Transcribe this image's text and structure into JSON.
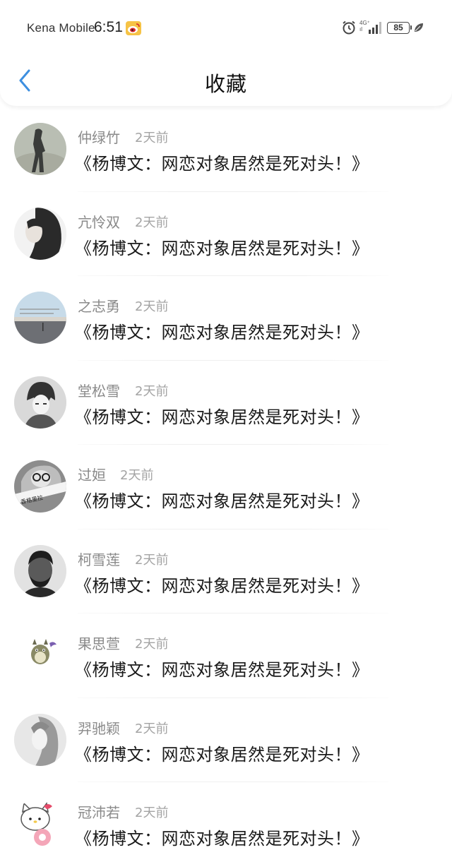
{
  "status_bar": {
    "carrier": "Kena Mobile",
    "time": "6:51",
    "network": "4G⁺",
    "network_sub": "ıl",
    "battery": "85"
  },
  "header": {
    "title": "收藏"
  },
  "items": [
    {
      "name": "仲绿竹",
      "time": "2天前",
      "title": "《杨博文：网恋对象居然是死对头！》"
    },
    {
      "name": "亢怜双",
      "time": "2天前",
      "title": "《杨博文：网恋对象居然是死对头！》"
    },
    {
      "name": "之志勇",
      "time": "2天前",
      "title": "《杨博文：网恋对象居然是死对头！》"
    },
    {
      "name": "堂松雪",
      "time": "2天前",
      "title": "《杨博文：网恋对象居然是死对头！》"
    },
    {
      "name": "过姮",
      "time": "2天前",
      "title": "《杨博文：网恋对象居然是死对头！》"
    },
    {
      "name": "柯雪莲",
      "time": "2天前",
      "title": "《杨博文：网恋对象居然是死对头！》"
    },
    {
      "name": "果思萱",
      "time": "2天前",
      "title": "《杨博文：网恋对象居然是死对头！》"
    },
    {
      "name": "羿驰颖",
      "time": "2天前",
      "title": "《杨博文：网恋对象居然是死对头！》"
    },
    {
      "name": "冠沛若",
      "time": "2天前",
      "title": "《杨博文：网恋对象居然是死对头！》"
    }
  ],
  "colors": {
    "accent": "#3d8fe0",
    "name_text": "#8a8a8a",
    "time_text": "#a4a4a4",
    "title_text": "#1a1a1a"
  }
}
